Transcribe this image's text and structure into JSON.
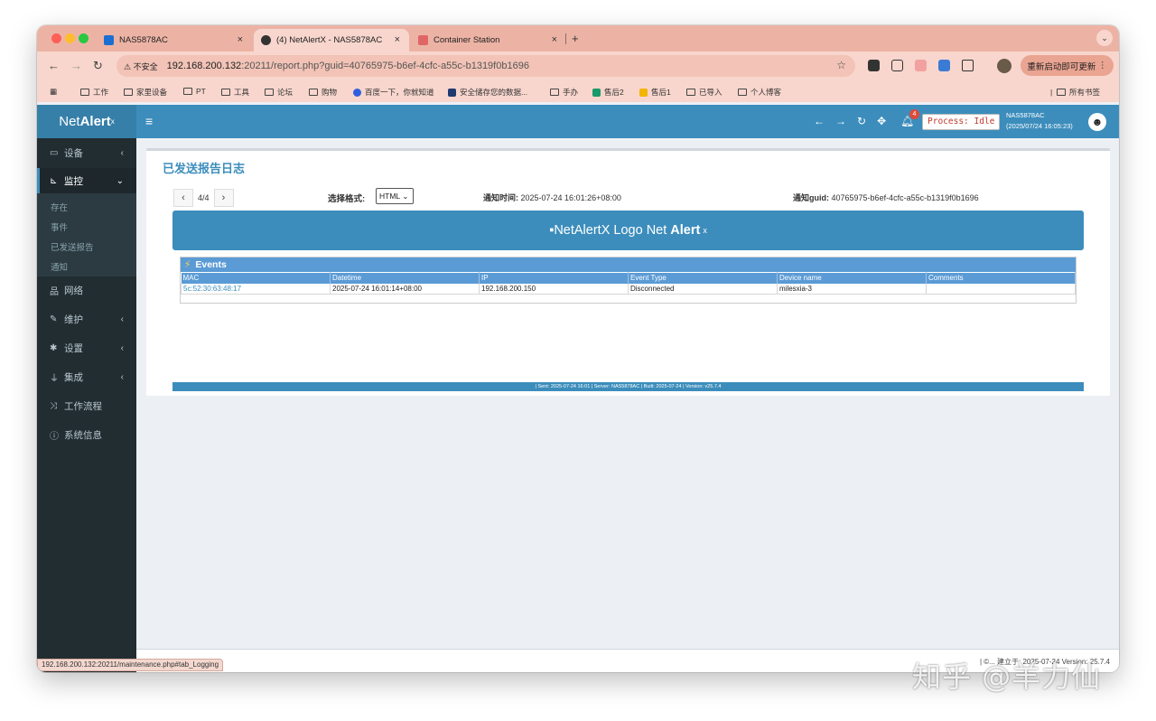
{
  "browser": {
    "tabs": [
      {
        "title": "NAS5878AC",
        "icon_color": "#1c6fd1"
      },
      {
        "title": "(4) NetAlertX - NAS5878AC",
        "icon_color": "#333333"
      },
      {
        "title": "Container Station",
        "icon_color": "#e06666"
      }
    ],
    "new_tab": "+",
    "url_warning": "不安全",
    "url_host": "192.168.200.132",
    "url_path": ":20211/report.php?guid=40765975-b6ef-4cfc-a55c-b1319f0b1696",
    "update_button": "重新启动即可更新",
    "bookmarks": [
      "工作",
      "家里设备",
      "PT",
      "工具",
      "论坛",
      "购物",
      "百度一下，你就知道",
      "安全储存您的数据...",
      "手办",
      "售后2",
      "售后1",
      "已导入",
      "个人博客"
    ],
    "all_bookmarks": "所有书签",
    "status_url": "192.168.200.132:20211/maintenance.php#tab_Logging"
  },
  "app": {
    "logo_light": "Net",
    "logo_bold": "Alert",
    "logo_sup": "x",
    "hamburger": "≡",
    "notification_count": "4",
    "process_status": "Process: Idle",
    "server_name": "NAS5878AC",
    "server_time": "(2025/07/24 16:05:23)"
  },
  "sidebar": {
    "items": [
      {
        "label": "设备",
        "icon": "laptop-icon"
      },
      {
        "label": "监控",
        "icon": "chart-icon"
      },
      {
        "label": "网络",
        "icon": "network-icon"
      },
      {
        "label": "维护",
        "icon": "wrench-icon"
      },
      {
        "label": "设置",
        "icon": "gear-icon"
      },
      {
        "label": "集成",
        "icon": "plug-icon"
      },
      {
        "label": "工作流程",
        "icon": "shuffle-icon"
      },
      {
        "label": "系统信息",
        "icon": "info-icon"
      }
    ],
    "submenu": [
      "存在",
      "事件",
      "已发送报告",
      "通知"
    ]
  },
  "report": {
    "title": "已发送报告日志",
    "pager": "4/4",
    "format_label": "选择格式:",
    "format_value": "HTML",
    "time_label": "通知时间:",
    "time_value": "2025-07-24 16:01:26+08:00",
    "guid_label": "通知guid:",
    "guid_value": "40765975-b6ef-4cfc-a55c-b1319f0b1696",
    "banner_img_alt": "NetAlertX Logo",
    "banner_net": "Net",
    "banner_alert": "Alert",
    "banner_sup": "x",
    "events_title": "Events",
    "columns": [
      "MAC",
      "Datetime",
      "IP",
      "Event Type",
      "Device name",
      "Comments"
    ],
    "rows": [
      [
        "5c:52:30:63:48:17",
        "2025-07-24 16:01:14+08:00",
        "192.168.200.150",
        "Disconnected",
        "milesxia-3",
        ""
      ]
    ],
    "footer": "| Sent: 2025-07-24 16:01 | Server: NAS5878AC | Built: 2025-07-24 | Version: v25.7.4"
  },
  "page_footer": "| ©... 建立于: 2025-07-24 Version: 25.7.4",
  "watermark": "知乎 @羊力仙"
}
